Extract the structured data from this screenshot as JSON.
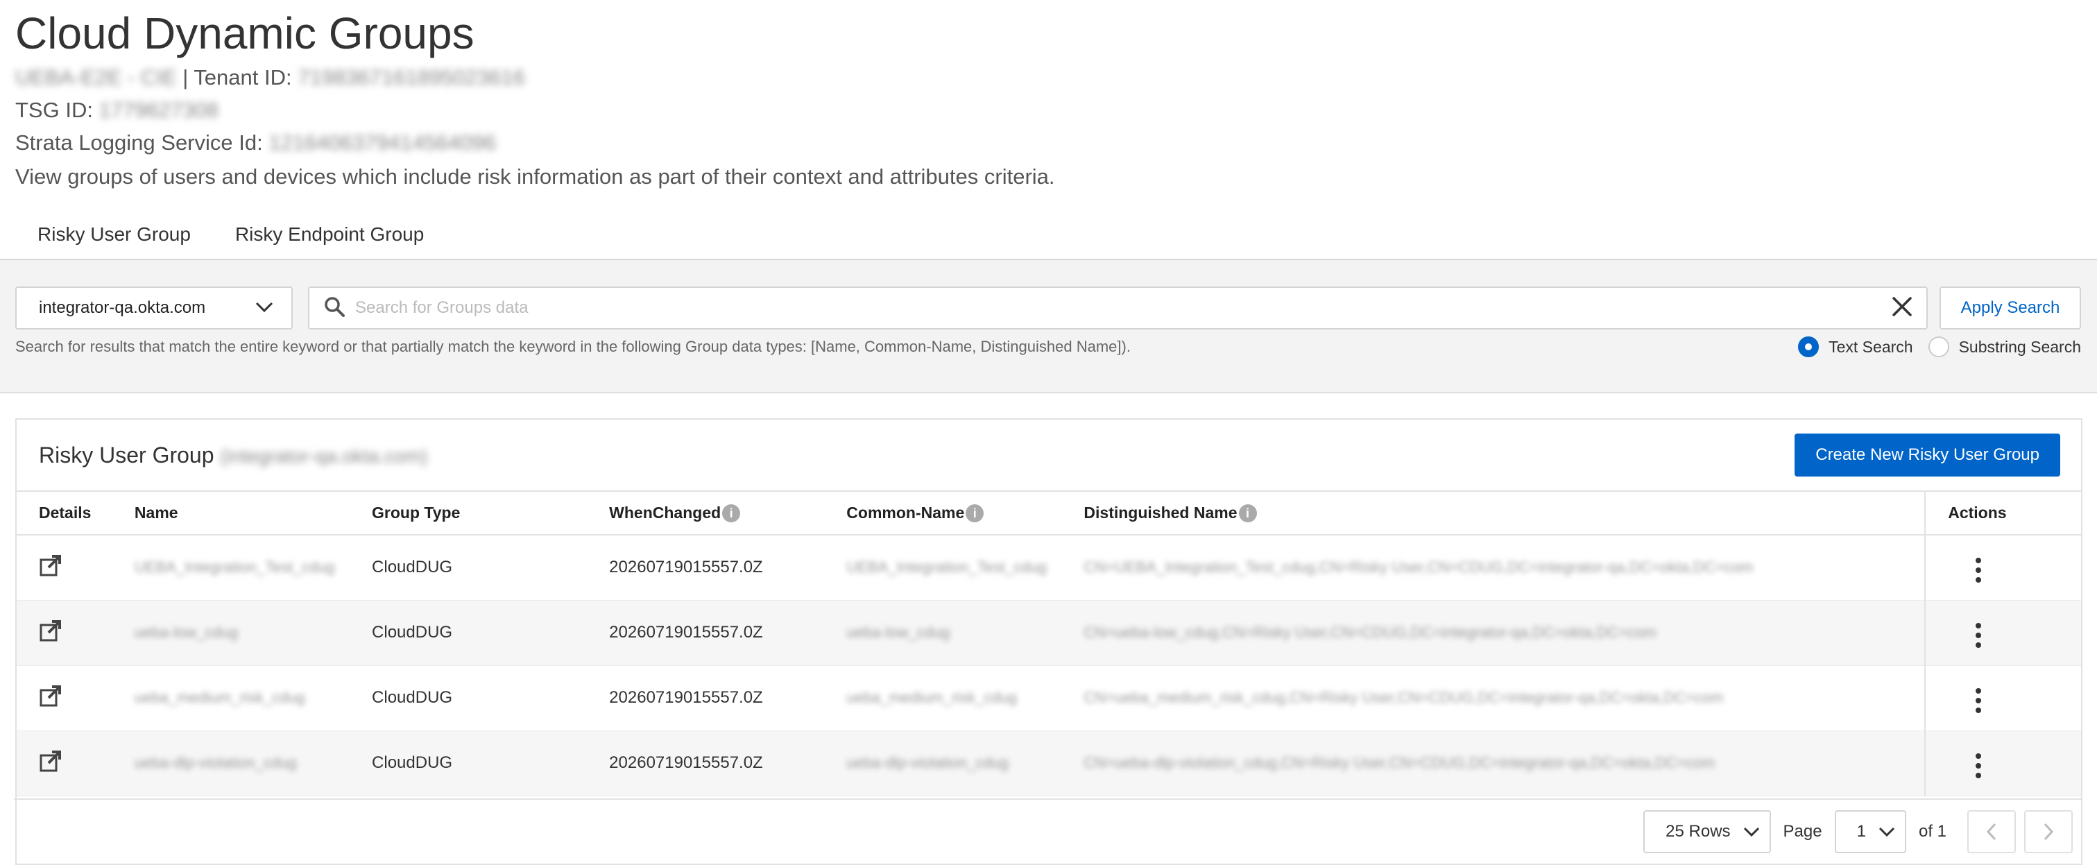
{
  "page": {
    "title": "Cloud Dynamic Groups",
    "tenant_name": "UEBA-E2E - CIE",
    "tenant_id_label": "| Tenant ID:",
    "tenant_id": "719836716189502361​6",
    "tsg_label": "TSG ID:",
    "tsg_id": "1779627308",
    "sls_label": "Strata Logging Service Id:",
    "sls_id": "1216406379414564096",
    "description": "View groups of users and devices which include risk information as part of their context and attributes criteria."
  },
  "tabs": [
    {
      "label": "Risky User Group",
      "active": true
    },
    {
      "label": "Risky Endpoint Group",
      "active": false
    }
  ],
  "search": {
    "domain_value": "integrator-qa.okta.com",
    "placeholder": "Search for Groups data",
    "apply_label": "Apply Search",
    "help_text": "Search for results that match the entire keyword or that partially match the keyword in the following Group data types: [Name, Common-Name, Distinguished Name]).",
    "radio_text": "Text Search",
    "radio_substring": "Substring Search",
    "selected_mode": "Text Search"
  },
  "card": {
    "title": "Risky User Group",
    "title_suffix": "(integrator-qa.okta.com)",
    "create_label": "Create New Risky User Group"
  },
  "table": {
    "headers": {
      "details": "Details",
      "name": "Name",
      "type": "Group Type",
      "when": "WhenChanged",
      "cn": "Common-Name",
      "dn": "Distinguished Name",
      "actions": "Actions"
    },
    "rows": [
      {
        "name": "UEBA_Integration_Test_cdug",
        "type": "CloudDUG",
        "when": "20260719015557.0Z",
        "cn": "UEBA_Integration_Test_cdug",
        "dn": "CN=UEBA_Integration_Test_cdug,CN=Risky User,CN=CDUG,DC=integrator-qa,DC=okta,DC=com"
      },
      {
        "name": "ueba-low_cdug",
        "type": "CloudDUG",
        "when": "20260719015557.0Z",
        "cn": "ueba-low_cdug",
        "dn": "CN=ueba-low_cdug,CN=Risky User,CN=CDUG,DC=integrator-qa,DC=okta,DC=com"
      },
      {
        "name": "ueba_medium_risk_cdug",
        "type": "CloudDUG",
        "when": "20260719015557.0Z",
        "cn": "ueba_medium_risk_cdug",
        "dn": "CN=ueba_medium_risk_cdug,CN=Risky User,CN=CDUG,DC=integrator-qa,DC=okta,DC=com"
      },
      {
        "name": "ueba-dlp-violation_cdug",
        "type": "CloudDUG",
        "when": "20260719015557.0Z",
        "cn": "ueba-dlp-violation_cdug",
        "dn": "CN=ueba-dlp-violation_cdug,CN=Risky User,CN=CDUG,DC=integrator-qa,DC=okta,DC=com"
      }
    ]
  },
  "pagination": {
    "rows_label": "25 Rows",
    "page_label": "Page",
    "page_value": "1",
    "of_label": "of 1"
  },
  "colors": {
    "accent": "#0064c8",
    "search_bg": "#f3f3f3"
  },
  "icons": {
    "open": "open-external-icon",
    "search": "search-icon",
    "clear": "close-icon",
    "chevron": "chevron-down-icon",
    "info": "info-icon",
    "kebab": "kebab-menu-icon"
  }
}
